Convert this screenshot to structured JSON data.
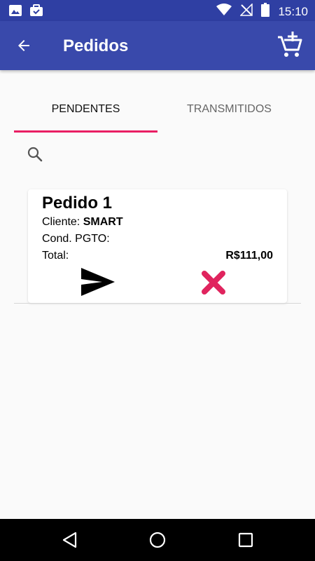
{
  "status_bar": {
    "time": "15:10"
  },
  "app_bar": {
    "title": "Pedidos"
  },
  "tabs": [
    {
      "label": "PENDENTES",
      "active": true
    },
    {
      "label": "TRANSMITIDOS",
      "active": false
    }
  ],
  "orders": [
    {
      "title": "Pedido 1",
      "cliente_label": "Cliente:",
      "cliente_value": "SMART",
      "cond_label": "Cond. PGTO:",
      "total_label": "Total:",
      "total_value": "R$111,00"
    }
  ],
  "colors": {
    "status_bar": "#2f3fa3",
    "app_bar": "#3949ab",
    "accent": "#e91e63",
    "background": "#fafafa"
  },
  "icons": [
    "image-icon",
    "briefcase-icon",
    "wifi-icon",
    "no-signal-icon",
    "battery-icon",
    "back-arrow-icon",
    "add-cart-icon",
    "search-icon",
    "send-icon",
    "cancel-icon",
    "nav-back-icon",
    "nav-home-icon",
    "nav-recents-icon"
  ]
}
